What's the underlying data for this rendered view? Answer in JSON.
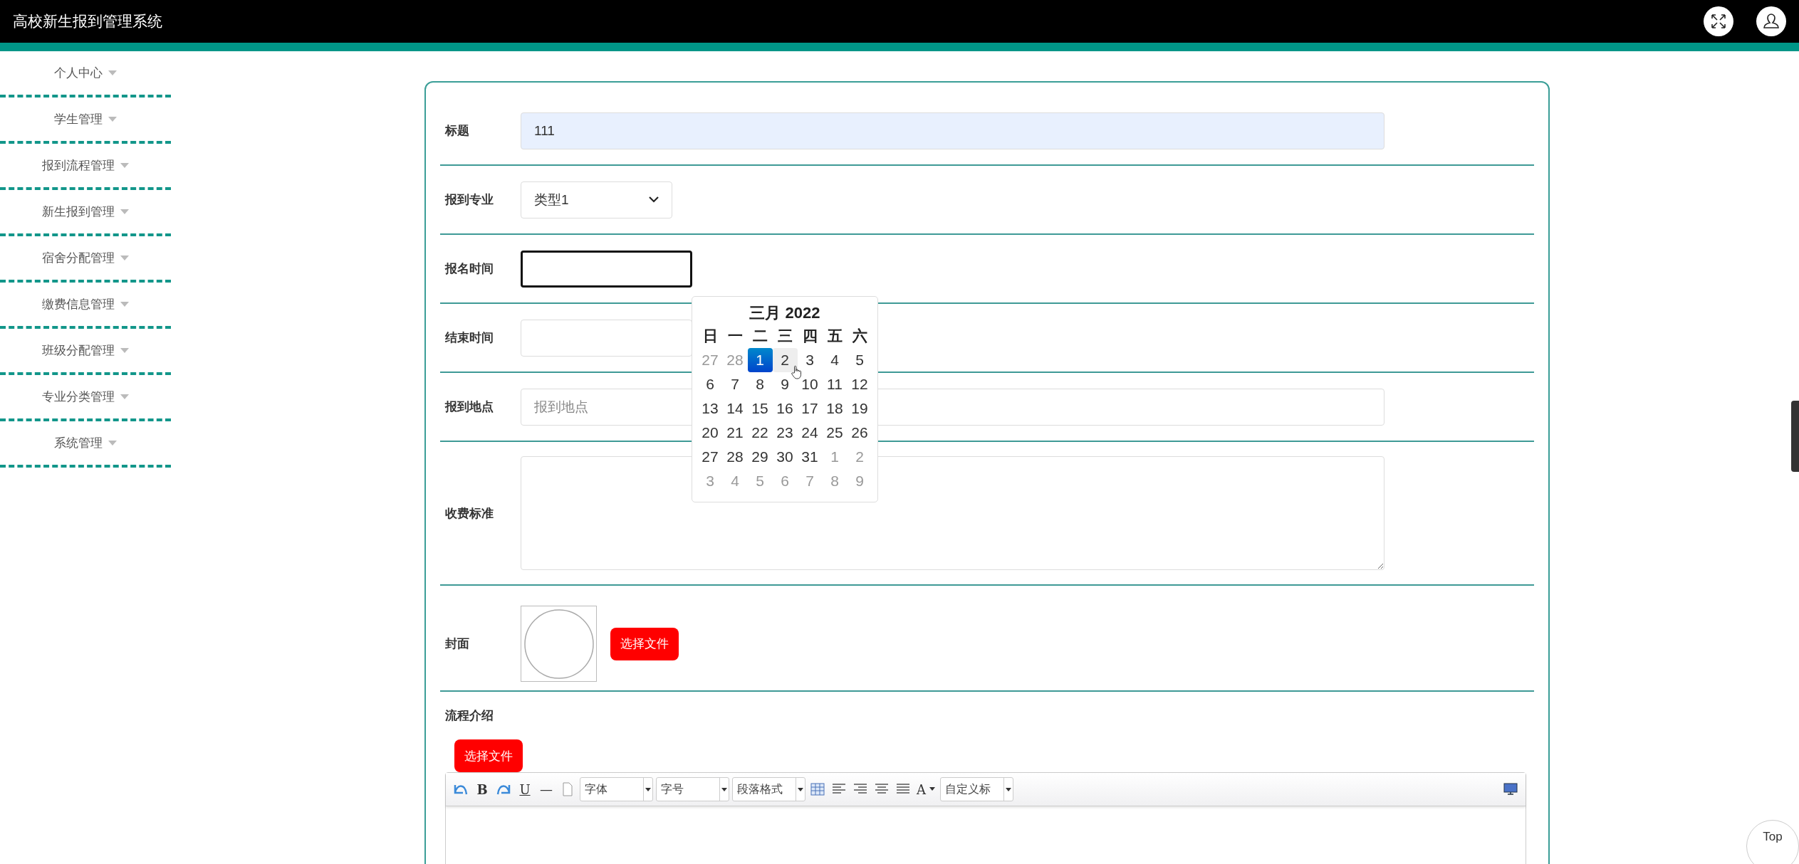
{
  "header": {
    "title": "高校新生报到管理系统"
  },
  "sidebar": {
    "items": [
      {
        "label": "个人中心"
      },
      {
        "label": "学生管理"
      },
      {
        "label": "报到流程管理"
      },
      {
        "label": "新生报到管理"
      },
      {
        "label": "宿舍分配管理"
      },
      {
        "label": "缴费信息管理"
      },
      {
        "label": "班级分配管理"
      },
      {
        "label": "专业分类管理"
      },
      {
        "label": "系统管理"
      }
    ]
  },
  "form": {
    "rows": [
      {
        "kind": "text",
        "label": "标题",
        "value": "111",
        "autofilled": true
      },
      {
        "kind": "select",
        "label": "报到专业",
        "value": "类型1"
      },
      {
        "kind": "date",
        "label": "报名时间",
        "focused": true,
        "picker": {
          "title": "三月 2022",
          "weekdays": [
            "日",
            "一",
            "二",
            "三",
            "四",
            "五",
            "六"
          ],
          "weeks": [
            [
              {
                "day": "27",
                "other": true,
                "selected": false,
                "hovered": false
              },
              {
                "day": "28",
                "other": true,
                "selected": false,
                "hovered": false
              },
              {
                "day": "1",
                "other": false,
                "selected": true,
                "hovered": false
              },
              {
                "day": "2",
                "other": false,
                "selected": false,
                "hovered": true
              },
              {
                "day": "3",
                "other": false,
                "selected": false,
                "hovered": false
              },
              {
                "day": "4",
                "other": false,
                "selected": false,
                "hovered": false
              },
              {
                "day": "5",
                "other": false,
                "selected": false,
                "hovered": false
              }
            ],
            [
              {
                "day": "6",
                "other": false,
                "selected": false,
                "hovered": false
              },
              {
                "day": "7",
                "other": false,
                "selected": false,
                "hovered": false
              },
              {
                "day": "8",
                "other": false,
                "selected": false,
                "hovered": false
              },
              {
                "day": "9",
                "other": false,
                "selected": false,
                "hovered": false
              },
              {
                "day": "10",
                "other": false,
                "selected": false,
                "hovered": false
              },
              {
                "day": "11",
                "other": false,
                "selected": false,
                "hovered": false
              },
              {
                "day": "12",
                "other": false,
                "selected": false,
                "hovered": false
              }
            ],
            [
              {
                "day": "13",
                "other": false,
                "selected": false,
                "hovered": false
              },
              {
                "day": "14",
                "other": false,
                "selected": false,
                "hovered": false
              },
              {
                "day": "15",
                "other": false,
                "selected": false,
                "hovered": false
              },
              {
                "day": "16",
                "other": false,
                "selected": false,
                "hovered": false
              },
              {
                "day": "17",
                "other": false,
                "selected": false,
                "hovered": false
              },
              {
                "day": "18",
                "other": false,
                "selected": false,
                "hovered": false
              },
              {
                "day": "19",
                "other": false,
                "selected": false,
                "hovered": false
              }
            ],
            [
              {
                "day": "20",
                "other": false,
                "selected": false,
                "hovered": false
              },
              {
                "day": "21",
                "other": false,
                "selected": false,
                "hovered": false
              },
              {
                "day": "22",
                "other": false,
                "selected": false,
                "hovered": false
              },
              {
                "day": "23",
                "other": false,
                "selected": false,
                "hovered": false
              },
              {
                "day": "24",
                "other": false,
                "selected": false,
                "hovered": false
              },
              {
                "day": "25",
                "other": false,
                "selected": false,
                "hovered": false
              },
              {
                "day": "26",
                "other": false,
                "selected": false,
                "hovered": false
              }
            ],
            [
              {
                "day": "27",
                "other": false,
                "selected": false,
                "hovered": false
              },
              {
                "day": "28",
                "other": false,
                "selected": false,
                "hovered": false
              },
              {
                "day": "29",
                "other": false,
                "selected": false,
                "hovered": false
              },
              {
                "day": "30",
                "other": false,
                "selected": false,
                "hovered": false
              },
              {
                "day": "31",
                "other": false,
                "selected": false,
                "hovered": false
              },
              {
                "day": "1",
                "other": true,
                "selected": false,
                "hovered": false
              },
              {
                "day": "2",
                "other": true,
                "selected": false,
                "hovered": false
              }
            ],
            [
              {
                "day": "3",
                "other": true,
                "selected": false,
                "hovered": false
              },
              {
                "day": "4",
                "other": true,
                "selected": false,
                "hovered": false
              },
              {
                "day": "5",
                "other": true,
                "selected": false,
                "hovered": false
              },
              {
                "day": "6",
                "other": true,
                "selected": false,
                "hovered": false
              },
              {
                "day": "7",
                "other": true,
                "selected": false,
                "hovered": false
              },
              {
                "day": "8",
                "other": true,
                "selected": false,
                "hovered": false
              },
              {
                "day": "9",
                "other": true,
                "selected": false,
                "hovered": false
              }
            ]
          ]
        }
      },
      {
        "kind": "date",
        "label": "结束时间",
        "focused": false
      },
      {
        "kind": "text",
        "label": "报到地点",
        "placeholder": "报到地点",
        "autofilled": false
      },
      {
        "kind": "textarea",
        "label": "收费标准"
      },
      {
        "kind": "image",
        "label": "封面",
        "button": "选择文件"
      }
    ]
  },
  "intro": {
    "label": "流程介绍",
    "button": "选择文件",
    "toolbar": [
      {
        "kind": "undo"
      },
      {
        "kind": "bold",
        "label": "B"
      },
      {
        "kind": "redo"
      },
      {
        "kind": "underline",
        "label": "U"
      },
      {
        "kind": "glyph",
        "label": "—"
      },
      {
        "kind": "page"
      },
      {
        "kind": "dropdown",
        "label": "字体"
      },
      {
        "kind": "dropdown",
        "label": "字号"
      },
      {
        "kind": "dropdown",
        "label": "段落格式"
      },
      {
        "kind": "table"
      },
      {
        "kind": "align-left"
      },
      {
        "kind": "align-right"
      },
      {
        "kind": "align-center"
      },
      {
        "kind": "justify"
      },
      {
        "kind": "color",
        "label": "A"
      },
      {
        "kind": "dropdown",
        "label": "自定义标"
      },
      {
        "kind": "fullscreen"
      }
    ]
  },
  "top_button": {
    "label": "Top"
  }
}
